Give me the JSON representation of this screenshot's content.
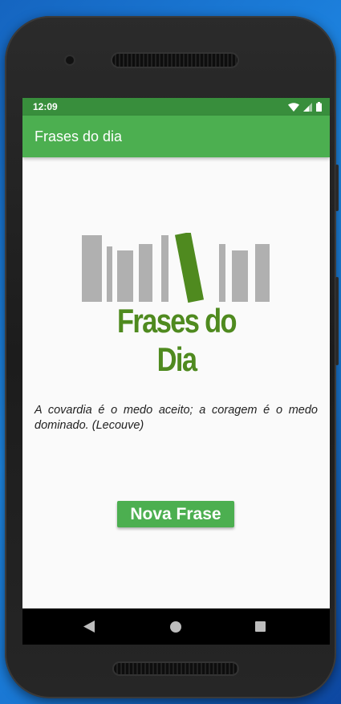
{
  "status_bar": {
    "time": "12:09",
    "icons": [
      "wifi-icon",
      "signal-icon",
      "battery-icon"
    ]
  },
  "app_bar": {
    "title": "Frases do dia"
  },
  "logo": {
    "text": "Frases do Dia",
    "color": "#4f8a1f"
  },
  "quote": {
    "text": "A covardia é o medo aceito; a coragem é o medo dominado. (Lecouve)"
  },
  "button": {
    "label": "Nova Frase"
  },
  "nav": {
    "icons": [
      "back-icon",
      "home-icon",
      "recent-apps-icon"
    ]
  },
  "colors": {
    "primary": "#4caf50",
    "primary_dark": "#388e3c",
    "logo_green": "#4f8a1f"
  }
}
